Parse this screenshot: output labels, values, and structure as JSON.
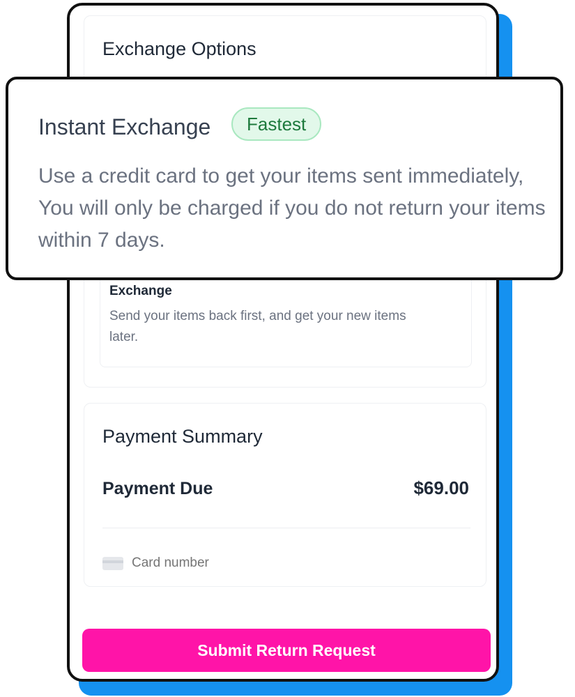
{
  "exchange_section": {
    "title": "Exchange Options",
    "standard_option": {
      "title": "Exchange",
      "description": "Send your items back first, and get your new items later."
    }
  },
  "instant_exchange_callout": {
    "title": "Instant Exchange",
    "badge": "Fastest",
    "description": "Use a credit card to get your items sent immediately, You will only be charged if you do not return your items within 7 days."
  },
  "payment_summary": {
    "title": "Payment Summary",
    "due_label": "Payment Due",
    "due_amount": "$69.00",
    "card_placeholder": "Card number",
    "card_icon": "credit-card-icon"
  },
  "submit_label": "Submit Return Request",
  "colors": {
    "accent": "#ff14a8",
    "shadow_blue": "#1591f0",
    "badge_bg": "#e2f8ea",
    "badge_text": "#1e7a3d"
  }
}
